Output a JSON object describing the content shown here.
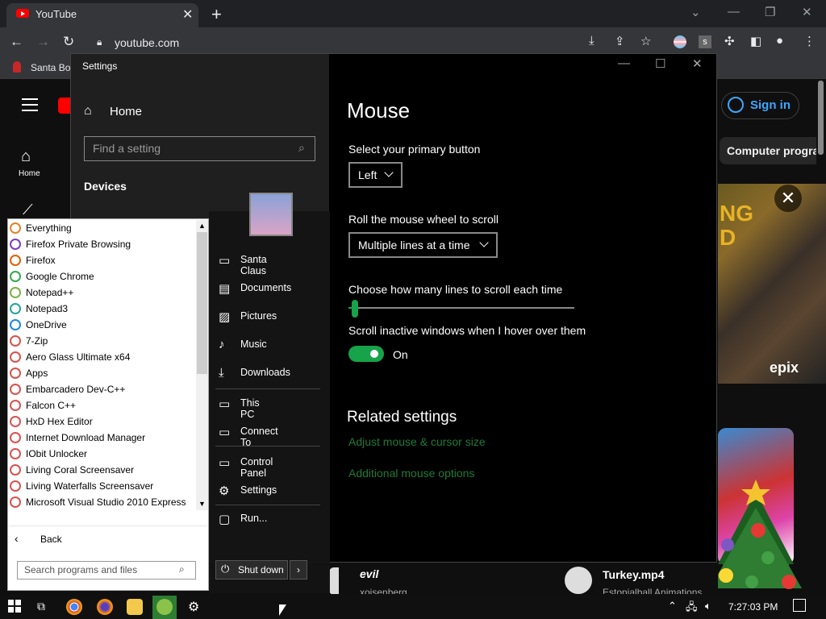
{
  "browser": {
    "tab_title": "YouTube",
    "url": "youtube.com",
    "bookmark": "Santa Bo"
  },
  "youtube": {
    "home_label": "Home",
    "sign_in": "Sign in",
    "chip": "Computer progra",
    "ad_art_text": "NG\nD",
    "ad_brand": "epix",
    "video1_title": "evil",
    "video1_channel": "xoisenberg",
    "video2_title": "Turkey.mp4",
    "video2_channel": "Estonialball Animations"
  },
  "settings": {
    "window_title": "Settings",
    "nav_home": "Home",
    "search_placeholder": "Find a setting",
    "section": "Devices",
    "page_title": "Mouse",
    "primary_button_label": "Select your primary button",
    "primary_button_value": "Left",
    "scroll_label": "Roll the mouse wheel to scroll",
    "scroll_value": "Multiple lines at a time",
    "lines_label": "Choose how many lines to scroll each time",
    "lines_value": 3,
    "inactive_label": "Scroll inactive windows when I hover over them",
    "inactive_state": "On",
    "related_title": "Related settings",
    "link1": "Adjust mouse & cursor size",
    "link2": "Additional mouse options"
  },
  "start_menu": {
    "programs": [
      {
        "label": "Everything",
        "color": "#e0832a"
      },
      {
        "label": "Firefox Private Browsing",
        "color": "#7b3fbf"
      },
      {
        "label": "Firefox",
        "color": "#e66000"
      },
      {
        "label": "Google Chrome",
        "color": "#34a853"
      },
      {
        "label": "Notepad++",
        "color": "#7cb342"
      },
      {
        "label": "Notepad3",
        "color": "#26a69a"
      },
      {
        "label": "OneDrive",
        "color": "#1e88e5"
      },
      {
        "label": "7-Zip",
        "color": "#d9534f"
      },
      {
        "label": "Aero Glass Ultimate x64",
        "color": "#d9534f"
      },
      {
        "label": "Apps",
        "color": "#d9534f"
      },
      {
        "label": "Embarcadero Dev-C++",
        "color": "#d9534f"
      },
      {
        "label": "Falcon C++",
        "color": "#d9534f"
      },
      {
        "label": "HxD Hex Editor",
        "color": "#d9534f"
      },
      {
        "label": "Internet Download Manager",
        "color": "#d9534f"
      },
      {
        "label": "IObit Unlocker",
        "color": "#d9534f"
      },
      {
        "label": "Living Coral Screensaver",
        "color": "#d9534f"
      },
      {
        "label": "Living Waterfalls Screensaver",
        "color": "#d9534f"
      },
      {
        "label": "Microsoft Visual Studio 2010 Express",
        "color": "#d9534f"
      }
    ],
    "back": "Back",
    "search_placeholder": "Search programs and files",
    "right_items": [
      {
        "label": "Santa Claus",
        "icon": "user-folder-icon"
      },
      {
        "label": "Documents",
        "icon": "documents-icon"
      },
      {
        "label": "Pictures",
        "icon": "pictures-icon"
      },
      {
        "label": "Music",
        "icon": "music-icon"
      },
      {
        "label": "Downloads",
        "icon": "downloads-icon"
      },
      {
        "label": "This PC",
        "icon": "computer-icon"
      },
      {
        "label": "Connect To",
        "icon": "connect-icon"
      },
      {
        "label": "Control Panel",
        "icon": "control-panel-icon"
      },
      {
        "label": "Settings",
        "icon": "gear-icon"
      },
      {
        "label": "Run...",
        "icon": "run-icon"
      }
    ],
    "shutdown": "Shut down"
  },
  "taskbar": {
    "clock": "7:27:03 PM"
  }
}
